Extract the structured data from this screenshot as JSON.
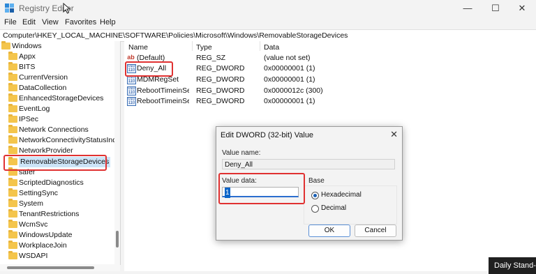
{
  "window": {
    "title": "Registry Editor",
    "controls": {
      "minimize": "—",
      "maximize": "☐",
      "close": "✕"
    }
  },
  "menu": [
    "File",
    "Edit",
    "View",
    "Favorites",
    "Help"
  ],
  "address": "Computer\\HKEY_LOCAL_MACHINE\\SOFTWARE\\Policies\\Microsoft\\Windows\\RemovableStorageDevices",
  "tree": {
    "root": "Windows",
    "items": [
      "Appx",
      "BITS",
      "CurrentVersion",
      "DataCollection",
      "EnhancedStorageDevices",
      "EventLog",
      "IPSec",
      "Network Connections",
      "NetworkConnectivityStatusIndic",
      "NetworkProvider",
      "RemovableStorageDevices",
      "safer",
      "ScriptedDiagnostics",
      "SettingSync",
      "System",
      "TenantRestrictions",
      "WcmSvc",
      "WindowsUpdate",
      "WorkplaceJoin",
      "WSDAPI"
    ],
    "selected": "RemovableStorageDevices"
  },
  "values_pane": {
    "columns": [
      "Name",
      "Type",
      "Data"
    ],
    "rows": [
      {
        "icon": "string-value-icon",
        "icon_text": "ab",
        "name": "(Default)",
        "type": "REG_SZ",
        "data": "(value not set)"
      },
      {
        "icon": "binary-value-icon",
        "icon_text": "010 110",
        "name": "Deny_All",
        "type": "REG_DWORD",
        "data": "0x00000001 (1)"
      },
      {
        "icon": "binary-value-icon",
        "icon_text": "010 110",
        "name": "MDMRegSet",
        "type": "REG_DWORD",
        "data": "0x00000001 (1)"
      },
      {
        "icon": "binary-value-icon",
        "icon_text": "010 110",
        "name": "RebootTimeinSe...",
        "type": "REG_DWORD",
        "data": "0x0000012c (300)"
      },
      {
        "icon": "binary-value-icon",
        "icon_text": "010 110",
        "name": "RebootTimeinSe...",
        "type": "REG_DWORD",
        "data": "0x00000001 (1)"
      }
    ]
  },
  "dialog": {
    "title": "Edit DWORD (32-bit) Value",
    "close": "✕",
    "value_name_label": "Value name:",
    "value_name": "Deny_All",
    "value_data_label": "Value data:",
    "value_data": "1",
    "base_label": "Base",
    "base_options": [
      {
        "label": "Hexadecimal",
        "selected": true
      },
      {
        "label": "Decimal",
        "selected": false
      }
    ],
    "ok": "OK",
    "cancel": "Cancel"
  },
  "taskbar_toast": "Daily Stand-...",
  "colors": {
    "highlight": "#e03131",
    "accent": "#2a6ecf",
    "selection": "#cce4f7"
  }
}
